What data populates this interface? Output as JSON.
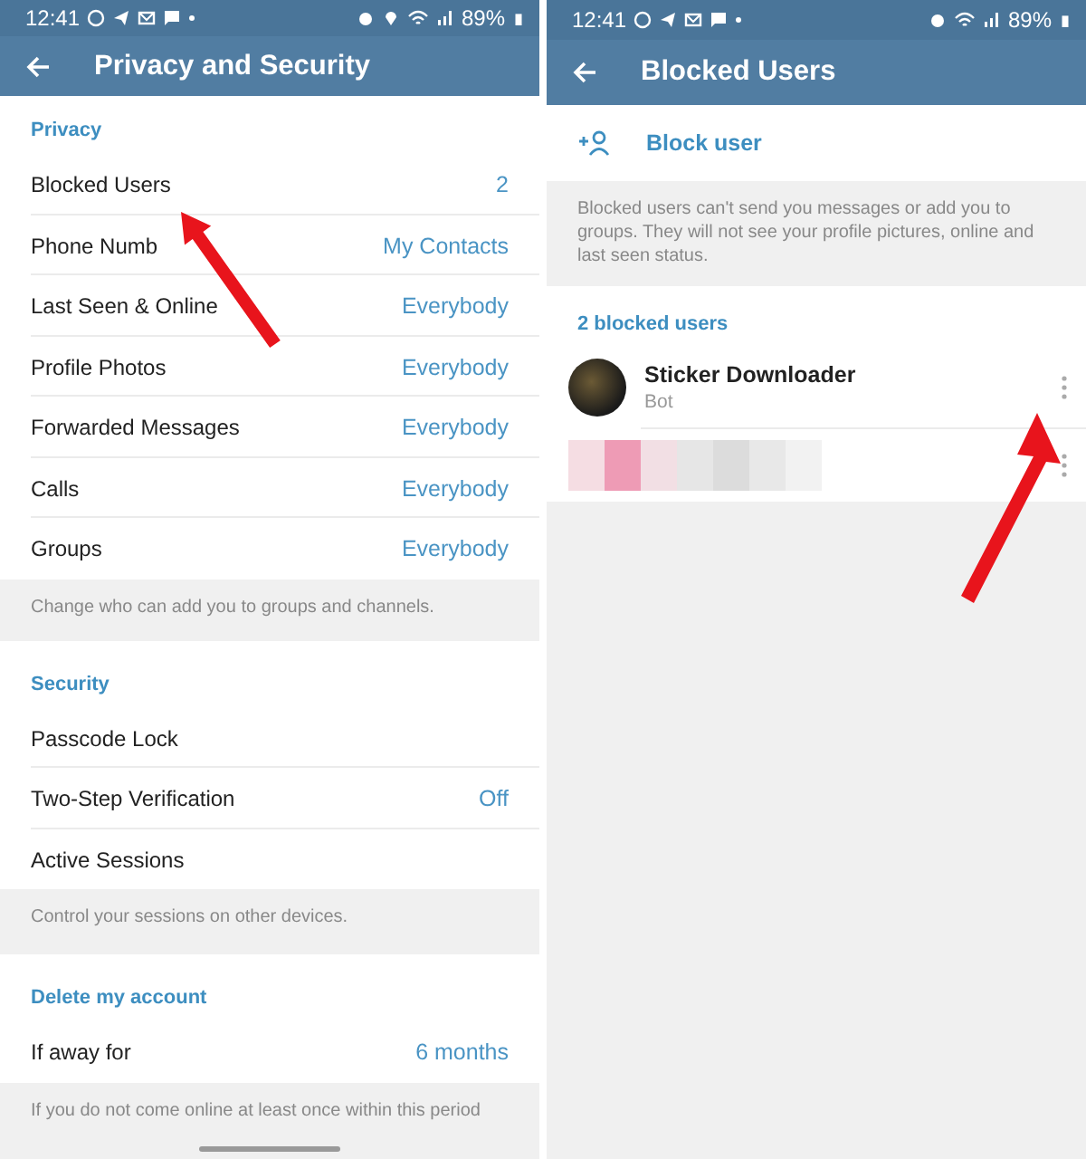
{
  "privacy_screen": {
    "status_bar": {
      "time": "12:41",
      "battery": "89%",
      "location": true
    },
    "title": "Privacy and Security",
    "sections": [
      {
        "header": "Privacy",
        "rows": [
          {
            "label": "Blocked Users",
            "value": "2"
          },
          {
            "label": "Phone Numb",
            "value": "My Contacts"
          },
          {
            "label": "Last Seen & Online",
            "value": "Everybody"
          },
          {
            "label": "Profile Photos",
            "value": "Everybody"
          },
          {
            "label": "Forwarded Messages",
            "value": "Everybody"
          },
          {
            "label": "Calls",
            "value": "Everybody"
          },
          {
            "label": "Groups",
            "value": "Everybody"
          }
        ],
        "footer": "Change who can add you to groups and channels."
      },
      {
        "header": "Security",
        "rows": [
          {
            "label": "Passcode Lock"
          },
          {
            "label": "Two-Step Verification",
            "value": "Off"
          },
          {
            "label": "Active Sessions"
          }
        ],
        "footer": "Control your sessions on other devices."
      },
      {
        "header": "Delete my account",
        "rows": [
          {
            "label": "If away for",
            "value": "6 months"
          }
        ],
        "footer": "If you do not come online at least once within this period"
      }
    ]
  },
  "blocked_screen": {
    "status_bar": {
      "time": "12:41",
      "battery": "89%",
      "location": false
    },
    "title": "Blocked Users",
    "action": "Block user",
    "info": "Blocked users can't send you messages or add you to groups. They will not see your profile pictures, online and last seen status.",
    "list_header": "2 blocked users",
    "users": [
      {
        "kind": "visible",
        "name": "Sticker Downloader",
        "subtitle": "Bot"
      },
      {
        "kind": "blurred"
      }
    ]
  }
}
